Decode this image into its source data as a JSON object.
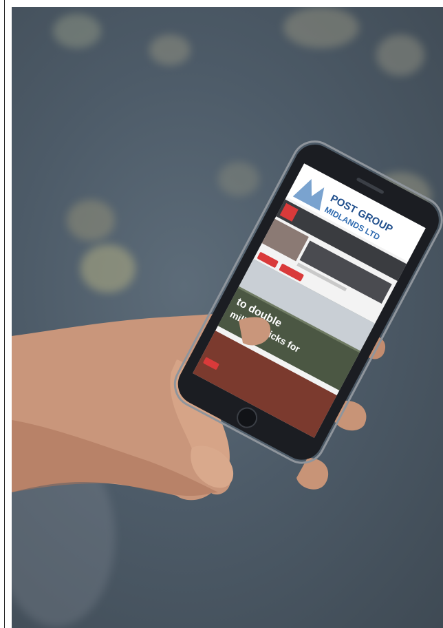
{
  "photo": {
    "subject": "hand-holding-smartphone",
    "background_color": "#4f5d6a"
  },
  "phone_screen": {
    "logo_line1": "POST GROUP",
    "logo_line2": "MIDLANDS LTD",
    "brand_color": "#1f4e8c",
    "accent_color": "#d93a3a",
    "headline_line1": "to double",
    "headline_line2": "million bricks for"
  }
}
